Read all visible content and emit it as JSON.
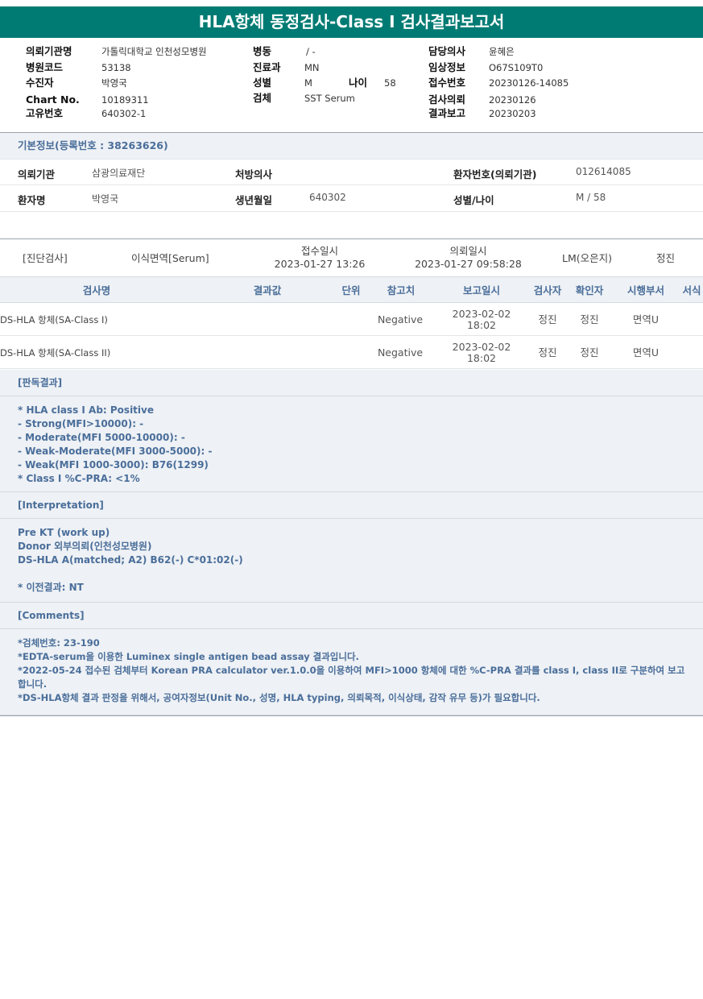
{
  "title": "HLA항체 동정검사-Class I 검사결과보고서",
  "header": {
    "col1": [
      {
        "label": "의뢰기관명",
        "value": "가톨릭대학교 인천성모병원"
      },
      {
        "label": "병원코드",
        "value": "53138"
      },
      {
        "label": "수진자",
        "value": "박영국"
      },
      {
        "label": "Chart No.",
        "value": "10189311"
      },
      {
        "label": "고유번호",
        "value": "640302-1"
      }
    ],
    "col2": [
      {
        "label": "병동",
        "value": "/ -"
      },
      {
        "label": "진료과",
        "value": "MN"
      },
      {
        "label": "성별",
        "value": "M"
      },
      {
        "label": "검체",
        "value": "SST Serum"
      }
    ],
    "age": {
      "label": "나이",
      "value": "58"
    },
    "col3": [
      {
        "label": "담당의사",
        "value": "윤혜은"
      },
      {
        "label": "임상정보",
        "value": "O67S109T0"
      },
      {
        "label": "접수번호",
        "value": "20230126-14085"
      },
      {
        "label": "검사의뢰",
        "value": "20230126"
      },
      {
        "label": "결과보고",
        "value": "20230203"
      }
    ]
  },
  "basic_info": {
    "heading": "기본정보(등록번호 : 38263626)",
    "rows": [
      [
        {
          "label": "의뢰기관",
          "value": "삼광의료재단"
        },
        {
          "label": "처방의사",
          "value": ""
        },
        {
          "label": "환자번호(의뢰기관)",
          "value": "012614085"
        }
      ],
      [
        {
          "label": "환자명",
          "value": "박영국"
        },
        {
          "label": "생년월일",
          "value": "640302"
        },
        {
          "label": "성별/나이",
          "value": "M / 58"
        }
      ]
    ]
  },
  "order": {
    "category": "[진단검사]",
    "dept": "이식면역[Serum]",
    "received_label": "접수일시",
    "received_value": "2023-01-27 13:26",
    "requested_label": "의뢰일시",
    "requested_value": "2023-01-27 09:58:28",
    "lm": "LM(오은지)",
    "staff": "정진"
  },
  "results_table": {
    "headers": [
      "검사명",
      "결과값",
      "단위",
      "참고치",
      "보고일시",
      "검사자",
      "확인자",
      "시행부서",
      "서식"
    ],
    "rows": [
      {
        "name": "DS-HLA 항체(SA-Class I)",
        "result": "",
        "unit": "",
        "reference": "Negative",
        "report_date": "2023-02-02",
        "report_time": "18:02",
        "tester": "정진",
        "confirmer": "정진",
        "dept": "면역U",
        "form": ""
      },
      {
        "name": "DS-HLA 항체(SA-Class II)",
        "result": "",
        "unit": "",
        "reference": "Negative",
        "report_date": "2023-02-02",
        "report_time": "18:02",
        "tester": "정진",
        "confirmer": "정진",
        "dept": "면역U",
        "form": ""
      }
    ]
  },
  "reading": {
    "heading": "[판독결과]",
    "lines": [
      "* HLA class I Ab: Positive",
      "- Strong(MFI>10000): -",
      "- Moderate(MFI 5000-10000): -",
      "- Weak-Moderate(MFI 3000-5000): -",
      "- Weak(MFI 1000-3000): B76(1299)",
      "* Class I %C-PRA: <1%"
    ]
  },
  "interpretation": {
    "heading": "[Interpretation]",
    "lines": [
      "Pre KT (work up)",
      "Donor 외부의뢰(인천성모병원)",
      "DS-HLA A(matched; A2) B62(-) C*01:02(-)",
      "",
      "* 이전결과: NT"
    ]
  },
  "comments": {
    "heading": "[Comments]",
    "lines": [
      "*검체번호: 23-190",
      "*EDTA-serum을 이용한 Luminex single antigen bead assay 결과입니다.",
      "*2022-05-24 접수된 검체부터 Korean PRA calculator ver.1.0.0을 이용하여 MFI>1000 항체에 대한 %C-PRA 결과를 class I, class II로 구분하여 보고합니다.",
      "*DS-HLA항체 결과 판정을 위해서, 공여자정보(Unit No., 성명, HLA typing, 의뢰목적, 이식상태, 감작 유무 등)가 필요합니다."
    ]
  },
  "colors": {
    "title_bg": "#007b73",
    "section_text": "#4a6e9a",
    "section_bg": "#eef1f5"
  }
}
